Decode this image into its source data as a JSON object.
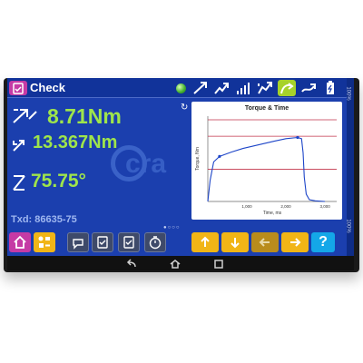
{
  "header": {
    "title": "Check",
    "logo_icon": "clipboard-check-icon",
    "status_color": "#49b533",
    "side_label": "100%"
  },
  "readings": {
    "peak_torque": "8.71Nm",
    "torque": "13.367Nm",
    "angle": "75.75°",
    "txd": "Txd: 86635-75"
  },
  "watermark": "cra",
  "page_indicator": "●○○○",
  "chart": {
    "title": "Torque & Time",
    "xlabel": "Time, ms",
    "ylabel": "Torque, Nm"
  },
  "chart_data": {
    "type": "line",
    "title": "Torque & Time",
    "xlabel": "Time, ms",
    "ylabel": "Torque, Nm",
    "x_tick_labels": [
      "1,000",
      "2,000",
      "3,000"
    ],
    "xlim": [
      0,
      3300
    ],
    "ylim": [
      0,
      14
    ],
    "limit_lines": [
      13.4,
      10.7,
      5.3
    ],
    "series": [
      {
        "x": [
          0,
          60,
          150,
          300,
          600,
          900,
          1300,
          1700,
          2000,
          2300,
          2400,
          2440,
          2470,
          2520,
          2600,
          2750,
          3000
        ],
        "y": [
          0,
          3.5,
          6.5,
          7.4,
          8.1,
          8.7,
          9.3,
          9.9,
          10.3,
          10.5,
          10.3,
          8,
          4,
          1.2,
          0.3,
          0.1,
          0
        ]
      }
    ],
    "markers": [
      {
        "x": 300,
        "y": 7.4
      },
      {
        "x": 2300,
        "y": 10.5
      }
    ],
    "grid": false
  },
  "toolbar": {
    "home_icon": "home-icon",
    "multi_icon": "multi-function-icon",
    "buttons": [
      "speech-bubble-icon",
      "checklist-icon",
      "checklist-icon",
      "timer-icon"
    ],
    "arrows": [
      "arrow-up-icon",
      "arrow-down-icon",
      "arrow-left-icon",
      "arrow-right-icon"
    ],
    "help_label": "?"
  },
  "colors": {
    "screen_bg": "#1b3fae",
    "reading": "#9fe54b",
    "accent_orange": "#f1b516",
    "accent_magenta": "#c53aa5",
    "help_blue": "#14a7e8",
    "limit_line": "#c2334a"
  }
}
